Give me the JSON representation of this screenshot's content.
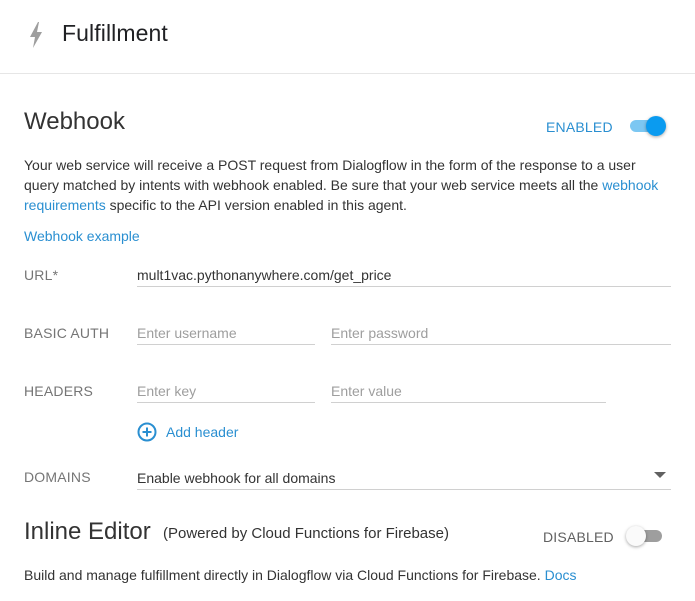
{
  "header": {
    "title": "Fulfillment",
    "icon": "lightning-bolt-icon"
  },
  "webhook": {
    "title": "Webhook",
    "status_label": "ENABLED",
    "enabled": true,
    "accent_color": "#0a9bf0",
    "desc_part1": "Your web service will receive a POST request from Dialogflow in the form of the response to a user query matched by intents with webhook enabled. Be sure that your web service meets all the ",
    "desc_link": "webhook requirements",
    "desc_part2": " specific to the API version enabled in this agent.",
    "example_link": "Webhook example",
    "url_label": "URL*",
    "url_value": "mult1vac.pythonanywhere.com/get_price",
    "basic_auth_label": "BASIC AUTH",
    "username_placeholder": "Enter username",
    "password_placeholder": "Enter password",
    "headers_label": "HEADERS",
    "key_placeholder": "Enter key",
    "value_placeholder": "Enter value",
    "add_header_label": "Add header",
    "domains_label": "DOMAINS",
    "domains_value": "Enable webhook for all domains"
  },
  "inline_editor": {
    "title": "Inline Editor",
    "subtitle": "(Powered by Cloud Functions for Firebase)",
    "status_label": "DISABLED",
    "enabled": false,
    "desc": "Build and manage fulfillment directly in Dialogflow via Cloud Functions for Firebase. ",
    "docs_link": "Docs"
  }
}
